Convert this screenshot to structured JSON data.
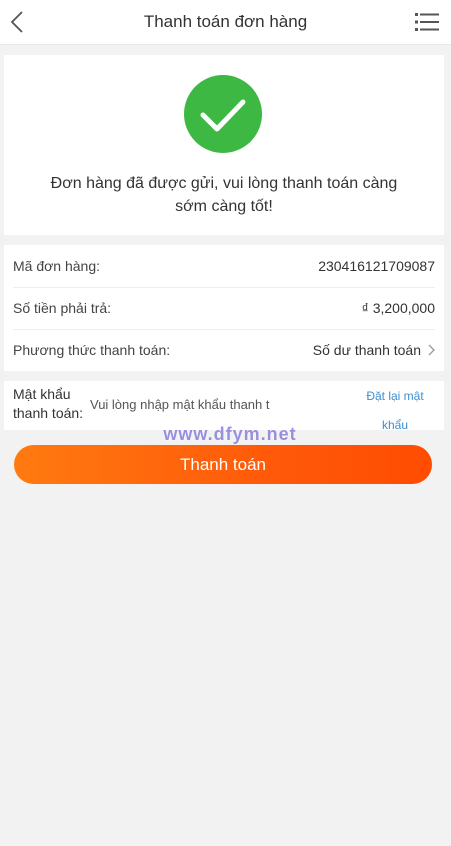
{
  "header": {
    "title": "Thanh toán đơn hàng",
    "back_icon": "chevron-left-icon",
    "menu_icon": "list-menu-icon"
  },
  "success": {
    "icon": "check-circle-icon",
    "icon_color": "#3cb843",
    "message": "Đơn hàng đã được gửi, vui lòng thanh toán càng sớm càng tốt!"
  },
  "order": {
    "id_label": "Mã đơn hàng:",
    "id_value": "230416121709087",
    "amount_label": "Số tiền phải trả:",
    "amount_value": "₫ 3,200,000",
    "method_label": "Phương thức thanh toán:",
    "method_value": "Số dư thanh toán"
  },
  "password": {
    "label": "Mật khẩu thanh toán:",
    "placeholder": "Vui lòng nhập mật khẩu thanh toán",
    "reset_label": "Đặt lại mật khẩu"
  },
  "watermark": "www.dfym.net",
  "pay_button": {
    "label": "Thanh toán",
    "color": "#ff6a0a"
  }
}
